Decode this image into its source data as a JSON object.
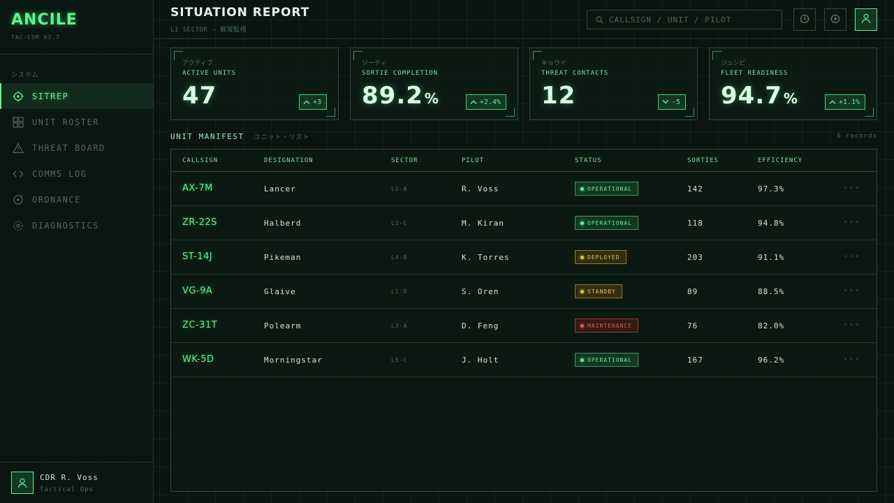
{
  "brand": {
    "name": "ANCILE",
    "version": "TAC-COM V3.7"
  },
  "sidebar": {
    "section_label": "システム",
    "items": [
      {
        "label": "SITREP",
        "icon": "crosshair-icon",
        "active": true
      },
      {
        "label": "UNIT ROSTER",
        "icon": "grid-icon",
        "active": false
      },
      {
        "label": "THREAT BOARD",
        "icon": "warning-triangle-icon",
        "active": false
      },
      {
        "label": "COMMS LOG",
        "icon": "code-brackets-icon",
        "active": false
      },
      {
        "label": "ORDNANCE",
        "icon": "target-ring-icon",
        "active": false
      },
      {
        "label": "DIAGNOSTICS",
        "icon": "dotted-ring-icon",
        "active": false
      }
    ],
    "user": {
      "name": "CDR R. Voss",
      "role": "Tactical Ops"
    }
  },
  "header": {
    "title": "SITUATION REPORT",
    "subtitle": "L1 SECTOR — 戦域監視",
    "search_placeholder": "CALLSIGN / UNIT / PILOT"
  },
  "stats": [
    {
      "jp": "アクティブ",
      "label": "ACTIVE UNITS",
      "value": "47",
      "unit": "",
      "delta": "+3",
      "direction": "up"
    },
    {
      "jp": "ソーティ",
      "label": "SORTIE COMPLETION",
      "value": "89.2",
      "unit": "%",
      "delta": "+2.4%",
      "direction": "up"
    },
    {
      "jp": "キョウイ",
      "label": "THREAT CONTACTS",
      "value": "12",
      "unit": "",
      "delta": "-5",
      "direction": "down"
    },
    {
      "jp": "ジュンビ",
      "label": "FLEET READINESS",
      "value": "94.7",
      "unit": "%",
      "delta": "+1.1%",
      "direction": "up"
    }
  ],
  "manifest": {
    "title": "UNIT MANIFEST",
    "title_jp": "ユニット・リスト",
    "record_count": "6 records",
    "columns": [
      "CALLSIGN",
      "DESIGNATION",
      "SECTOR",
      "PILOT",
      "STATUS",
      "SORTIES",
      "EFFICIENCY"
    ],
    "rows": [
      {
        "callsign": "AX-7M",
        "designation": "Lancer",
        "sector": "L1-A",
        "pilot": "R. Voss",
        "status": "OPERATIONAL",
        "status_color": "green",
        "sorties": "142",
        "efficiency": "97.3%"
      },
      {
        "callsign": "ZR-22S",
        "designation": "Halberd",
        "sector": "L2-C",
        "pilot": "M. Kiran",
        "status": "OPERATIONAL",
        "status_color": "green",
        "sorties": "118",
        "efficiency": "94.8%"
      },
      {
        "callsign": "ST-14J",
        "designation": "Pikeman",
        "sector": "L4-B",
        "pilot": "K. Torres",
        "status": "DEPLOYED",
        "status_color": "amber",
        "sorties": "203",
        "efficiency": "91.1%"
      },
      {
        "callsign": "VG-9A",
        "designation": "Glaive",
        "sector": "L1-D",
        "pilot": "S. Oren",
        "status": "STANDBY",
        "status_color": "amber",
        "sorties": "89",
        "efficiency": "88.5%"
      },
      {
        "callsign": "ZC-31T",
        "designation": "Polearm",
        "sector": "L3-A",
        "pilot": "D. Feng",
        "status": "MAINTENANCE",
        "status_color": "red",
        "sorties": "76",
        "efficiency": "82.0%"
      },
      {
        "callsign": "WK-5D",
        "designation": "Morningstar",
        "sector": "L5-C",
        "pilot": "J. Holt",
        "status": "OPERATIONAL",
        "status_color": "green",
        "sorties": "167",
        "efficiency": "96.2%"
      }
    ]
  },
  "colors": {
    "accent": "#5ef58c",
    "amber": "#f5c23e",
    "red": "#f2554e",
    "background": "#0a1411"
  }
}
